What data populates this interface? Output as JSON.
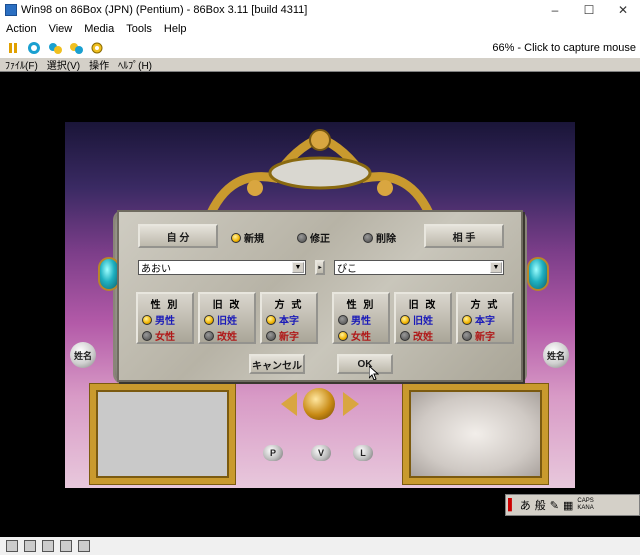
{
  "window": {
    "title": "Win98 on 86Box (JPN) (Pentium) - 86Box 3.11 [build 4311]",
    "minimize_glyph": "–",
    "maximize_glyph": "☐",
    "close_glyph": "✕"
  },
  "menubar": {
    "items": [
      "Action",
      "View",
      "Media",
      "Tools",
      "Help"
    ]
  },
  "toolbar": {
    "icons": [
      "pause-icon",
      "reset-icon",
      "ctrl-alt-del-icon",
      "ctrl-alt-esc-icon",
      "settings-icon"
    ],
    "status": "66% - Click to capture mouse"
  },
  "guest_menu": {
    "items": [
      "ﾌｧｲﾙ(F)",
      "選択(V)",
      "操作",
      "ﾍﾙﾌﾟ(H)"
    ]
  },
  "dialog": {
    "self_button": "自 分",
    "partner_button": "相 手",
    "modes": [
      {
        "label": "新規",
        "selected": true
      },
      {
        "label": "修正",
        "selected": false
      },
      {
        "label": "削除",
        "selected": false
      }
    ],
    "left_name": "あおい",
    "right_name": "ぴこ",
    "left_group": {
      "headers": [
        "性 別",
        "旧 改",
        "方 式"
      ],
      "gender": [
        {
          "label": "男性",
          "selected": true
        },
        {
          "label": "女性",
          "selected": false
        }
      ],
      "surname": [
        {
          "label": "旧姓",
          "selected": true
        },
        {
          "label": "改姓",
          "selected": false
        }
      ],
      "method": [
        {
          "label": "本字",
          "selected": true
        },
        {
          "label": "新字",
          "selected": false
        }
      ]
    },
    "right_group": {
      "headers": [
        "性 別",
        "旧 改",
        "方 式"
      ],
      "gender": [
        {
          "label": "男性",
          "selected": false
        },
        {
          "label": "女性",
          "selected": true
        }
      ],
      "surname": [
        {
          "label": "旧姓",
          "selected": true
        },
        {
          "label": "改姓",
          "selected": false
        }
      ],
      "method": [
        {
          "label": "本字",
          "selected": true
        },
        {
          "label": "新字",
          "selected": false
        }
      ]
    },
    "cancel_button": "キャンセル",
    "ok_button": "OK"
  },
  "scene": {
    "name_badge_left": "姓名",
    "name_badge_right": "姓名",
    "small_buttons": [
      "P",
      "V",
      "L"
    ]
  },
  "ime": {
    "mode": "あ",
    "conversion": "般",
    "extra": "CAPS KANA"
  }
}
